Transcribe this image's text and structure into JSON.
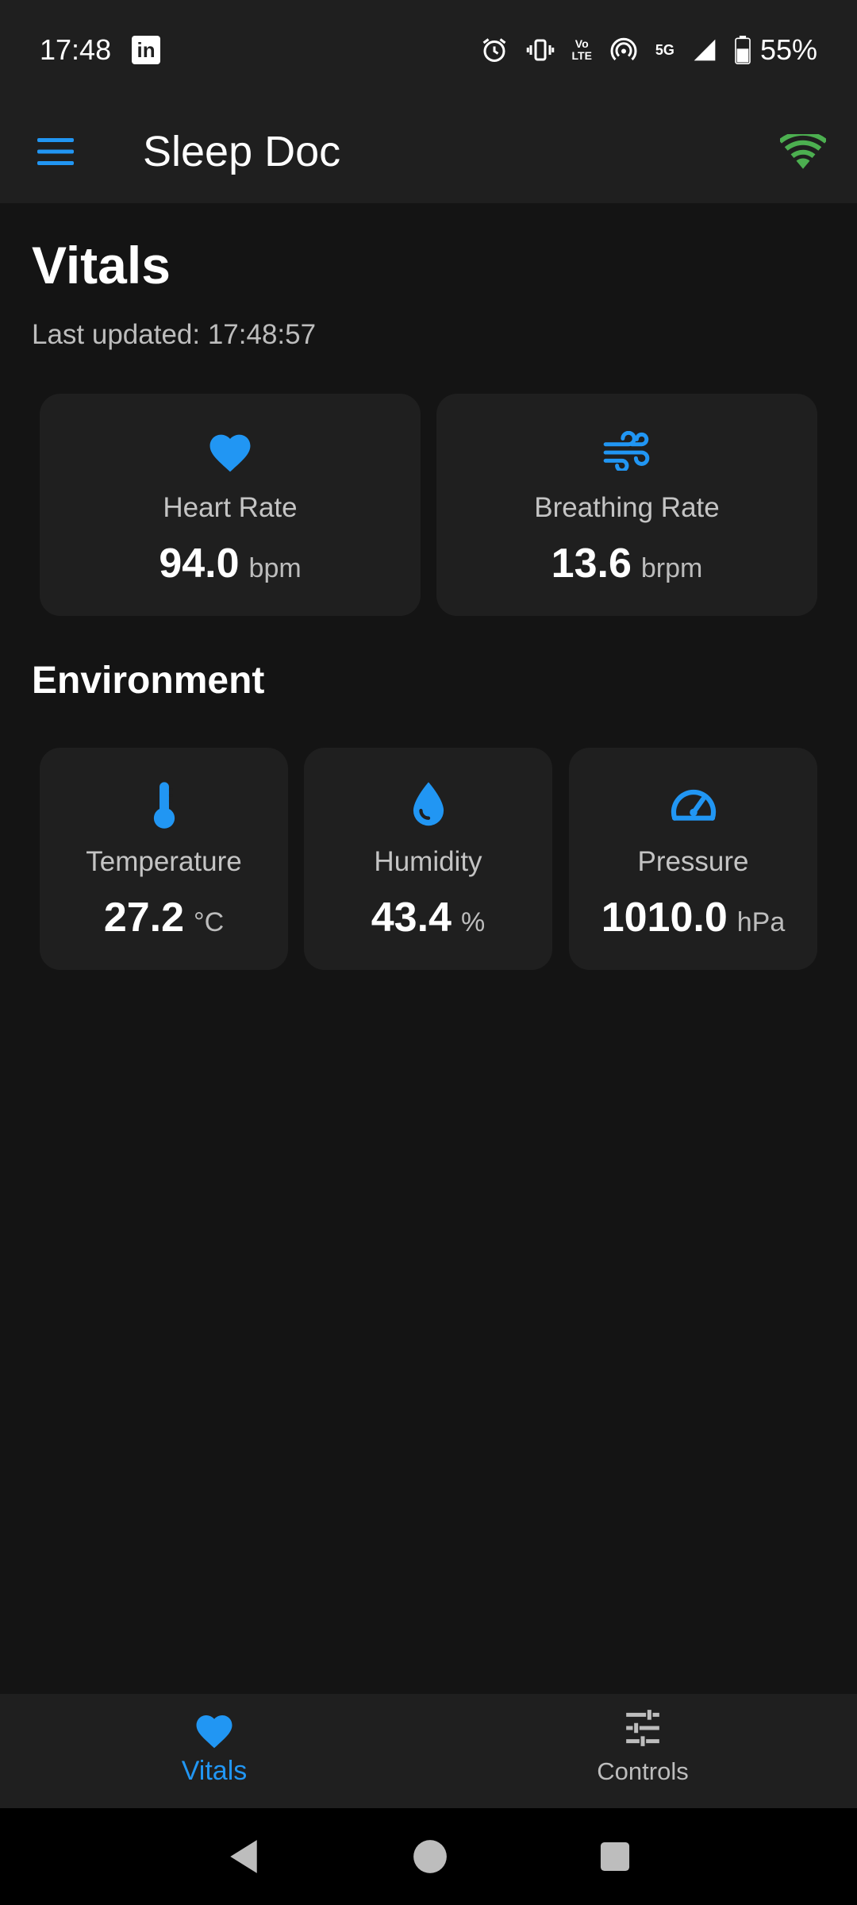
{
  "status_bar": {
    "time": "17:48",
    "network": "5G",
    "battery": "55%"
  },
  "app_bar": {
    "title": "Sleep Doc"
  },
  "page": {
    "title": "Vitals",
    "last_updated": "Last updated: 17:48:57"
  },
  "vitals": [
    {
      "label": "Heart Rate",
      "value": "94.0",
      "unit": "bpm",
      "icon": "heart-icon"
    },
    {
      "label": "Breathing Rate",
      "value": "13.6",
      "unit": "brpm",
      "icon": "air-icon"
    }
  ],
  "environment": {
    "title": "Environment",
    "items": [
      {
        "label": "Temperature",
        "value": "27.2",
        "unit": "°C",
        "icon": "thermometer-icon"
      },
      {
        "label": "Humidity",
        "value": "43.4",
        "unit": "%",
        "icon": "water-drop-icon"
      },
      {
        "label": "Pressure",
        "value": "1010.0",
        "unit": "hPa",
        "icon": "speedometer-icon"
      }
    ]
  },
  "bottom_nav": {
    "items": [
      {
        "label": "Vitals",
        "icon": "heart-icon",
        "active": true
      },
      {
        "label": "Controls",
        "icon": "tune-icon",
        "active": false
      }
    ]
  },
  "colors": {
    "accent": "#2196f3",
    "wifi": "#4caf50",
    "background": "#141414",
    "surface": "#1f1f1f"
  }
}
